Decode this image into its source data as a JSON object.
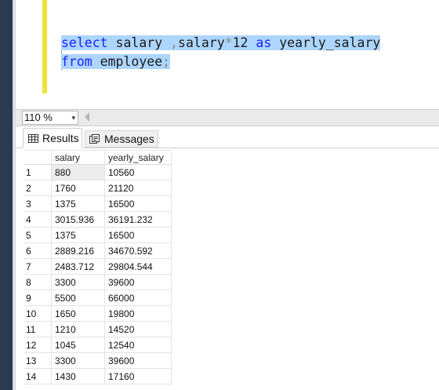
{
  "editor": {
    "line1": {
      "kw_select": "select",
      "t1": " salary ",
      "t2": ",",
      "t3": "salary",
      "t4": "*",
      "t5": "12 ",
      "kw_as": "as",
      "t6": " yearly_salary"
    },
    "line2": {
      "kw_from": "from",
      "t1": " employee",
      "t2": ";"
    }
  },
  "zoom": {
    "value": "110 %",
    "arrow": "▾"
  },
  "tabs": {
    "results_label": "Results",
    "messages_label": "Messages"
  },
  "grid": {
    "columns": [
      "salary",
      "yearly_salary"
    ],
    "rows": [
      {
        "n": "1",
        "salary": "880",
        "yearly_salary": "10560"
      },
      {
        "n": "2",
        "salary": "1760",
        "yearly_salary": "21120"
      },
      {
        "n": "3",
        "salary": "1375",
        "yearly_salary": "16500"
      },
      {
        "n": "4",
        "salary": "3015.936",
        "yearly_salary": "36191.232"
      },
      {
        "n": "5",
        "salary": "1375",
        "yearly_salary": "16500"
      },
      {
        "n": "6",
        "salary": "2889.216",
        "yearly_salary": "34670.592"
      },
      {
        "n": "7",
        "salary": "2483.712",
        "yearly_salary": "29804.544"
      },
      {
        "n": "8",
        "salary": "3300",
        "yearly_salary": "39600"
      },
      {
        "n": "9",
        "salary": "5500",
        "yearly_salary": "66000"
      },
      {
        "n": "10",
        "salary": "1650",
        "yearly_salary": "19800"
      },
      {
        "n": "11",
        "salary": "1210",
        "yearly_salary": "14520"
      },
      {
        "n": "12",
        "salary": "1045",
        "yearly_salary": "12540"
      },
      {
        "n": "13",
        "salary": "3300",
        "yearly_salary": "39600"
      },
      {
        "n": "14",
        "salary": "1430",
        "yearly_salary": "17160"
      }
    ]
  },
  "icons": {
    "results": "grid-icon",
    "messages": "messages-icon"
  },
  "colors": {
    "keyword": "#1d1dff",
    "selection": "#add6ff",
    "change_marker": "#f2e13b",
    "frame": "#2b3b4f"
  }
}
